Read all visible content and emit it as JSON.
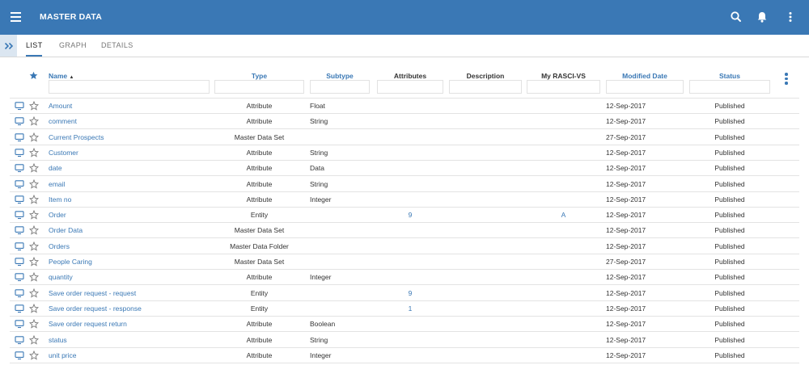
{
  "header": {
    "title": "MASTER DATA",
    "menu_icon": "hamburger-menu-icon",
    "search_icon": "search-icon",
    "notification_icon": "bell-icon",
    "more_icon": "more-vertical-icon",
    "bg_color": "#3a78b5"
  },
  "tabs": [
    {
      "label": "LIST",
      "active": true
    },
    {
      "label": "GRAPH",
      "active": false
    },
    {
      "label": "DETAILS",
      "active": false
    }
  ],
  "table": {
    "columns": {
      "name": "Name",
      "name_sort": "▲",
      "type": "Type",
      "subtype": "Subtype",
      "attributes": "Attributes",
      "description": "Description",
      "rasci": "My RASCI-VS",
      "modified": "Modified Date",
      "status": "Status"
    },
    "rows": [
      {
        "name": "Amount",
        "type": "Attribute",
        "subtype": "Float",
        "attributes": "",
        "rasci": "",
        "modified": "12-Sep-2017",
        "status": "Published"
      },
      {
        "name": "comment",
        "type": "Attribute",
        "subtype": "String",
        "attributes": "",
        "rasci": "",
        "modified": "12-Sep-2017",
        "status": "Published"
      },
      {
        "name": "Current Prospects",
        "type": "Master Data Set",
        "subtype": "",
        "attributes": "",
        "rasci": "",
        "modified": "27-Sep-2017",
        "status": "Published"
      },
      {
        "name": "Customer",
        "type": "Attribute",
        "subtype": "String",
        "attributes": "",
        "rasci": "",
        "modified": "12-Sep-2017",
        "status": "Published"
      },
      {
        "name": "date",
        "type": "Attribute",
        "subtype": "Data",
        "attributes": "",
        "rasci": "",
        "modified": "12-Sep-2017",
        "status": "Published"
      },
      {
        "name": "email",
        "type": "Attribute",
        "subtype": "String",
        "attributes": "",
        "rasci": "",
        "modified": "12-Sep-2017",
        "status": "Published"
      },
      {
        "name": "Item no",
        "type": "Attribute",
        "subtype": "Integer",
        "attributes": "",
        "rasci": "",
        "modified": "12-Sep-2017",
        "status": "Published"
      },
      {
        "name": "Order",
        "type": "Entity",
        "subtype": "",
        "attributes": "9",
        "rasci": "A",
        "modified": "12-Sep-2017",
        "status": "Published"
      },
      {
        "name": "Order Data",
        "type": "Master Data Set",
        "subtype": "",
        "attributes": "",
        "rasci": "",
        "modified": "12-Sep-2017",
        "status": "Published"
      },
      {
        "name": "Orders",
        "type": "Master Data Folder",
        "subtype": "",
        "attributes": "",
        "rasci": "",
        "modified": "12-Sep-2017",
        "status": "Published"
      },
      {
        "name": "People Caring",
        "type": "Master Data Set",
        "subtype": "",
        "attributes": "",
        "rasci": "",
        "modified": "27-Sep-2017",
        "status": "Published"
      },
      {
        "name": "quantity",
        "type": "Attribute",
        "subtype": "Integer",
        "attributes": "",
        "rasci": "",
        "modified": "12-Sep-2017",
        "status": "Published"
      },
      {
        "name": "Save order request - request",
        "type": "Entity",
        "subtype": "",
        "attributes": "9",
        "rasci": "",
        "modified": "12-Sep-2017",
        "status": "Published"
      },
      {
        "name": "Save order request - response",
        "type": "Entity",
        "subtype": "",
        "attributes": "1",
        "rasci": "",
        "modified": "12-Sep-2017",
        "status": "Published"
      },
      {
        "name": "Save order request return",
        "type": "Attribute",
        "subtype": "Boolean",
        "attributes": "",
        "rasci": "",
        "modified": "12-Sep-2017",
        "status": "Published"
      },
      {
        "name": "status",
        "type": "Attribute",
        "subtype": "String",
        "attributes": "",
        "rasci": "",
        "modified": "12-Sep-2017",
        "status": "Published"
      },
      {
        "name": "unit price",
        "type": "Attribute",
        "subtype": "Integer",
        "attributes": "",
        "rasci": "",
        "modified": "12-Sep-2017",
        "status": "Published"
      }
    ]
  }
}
